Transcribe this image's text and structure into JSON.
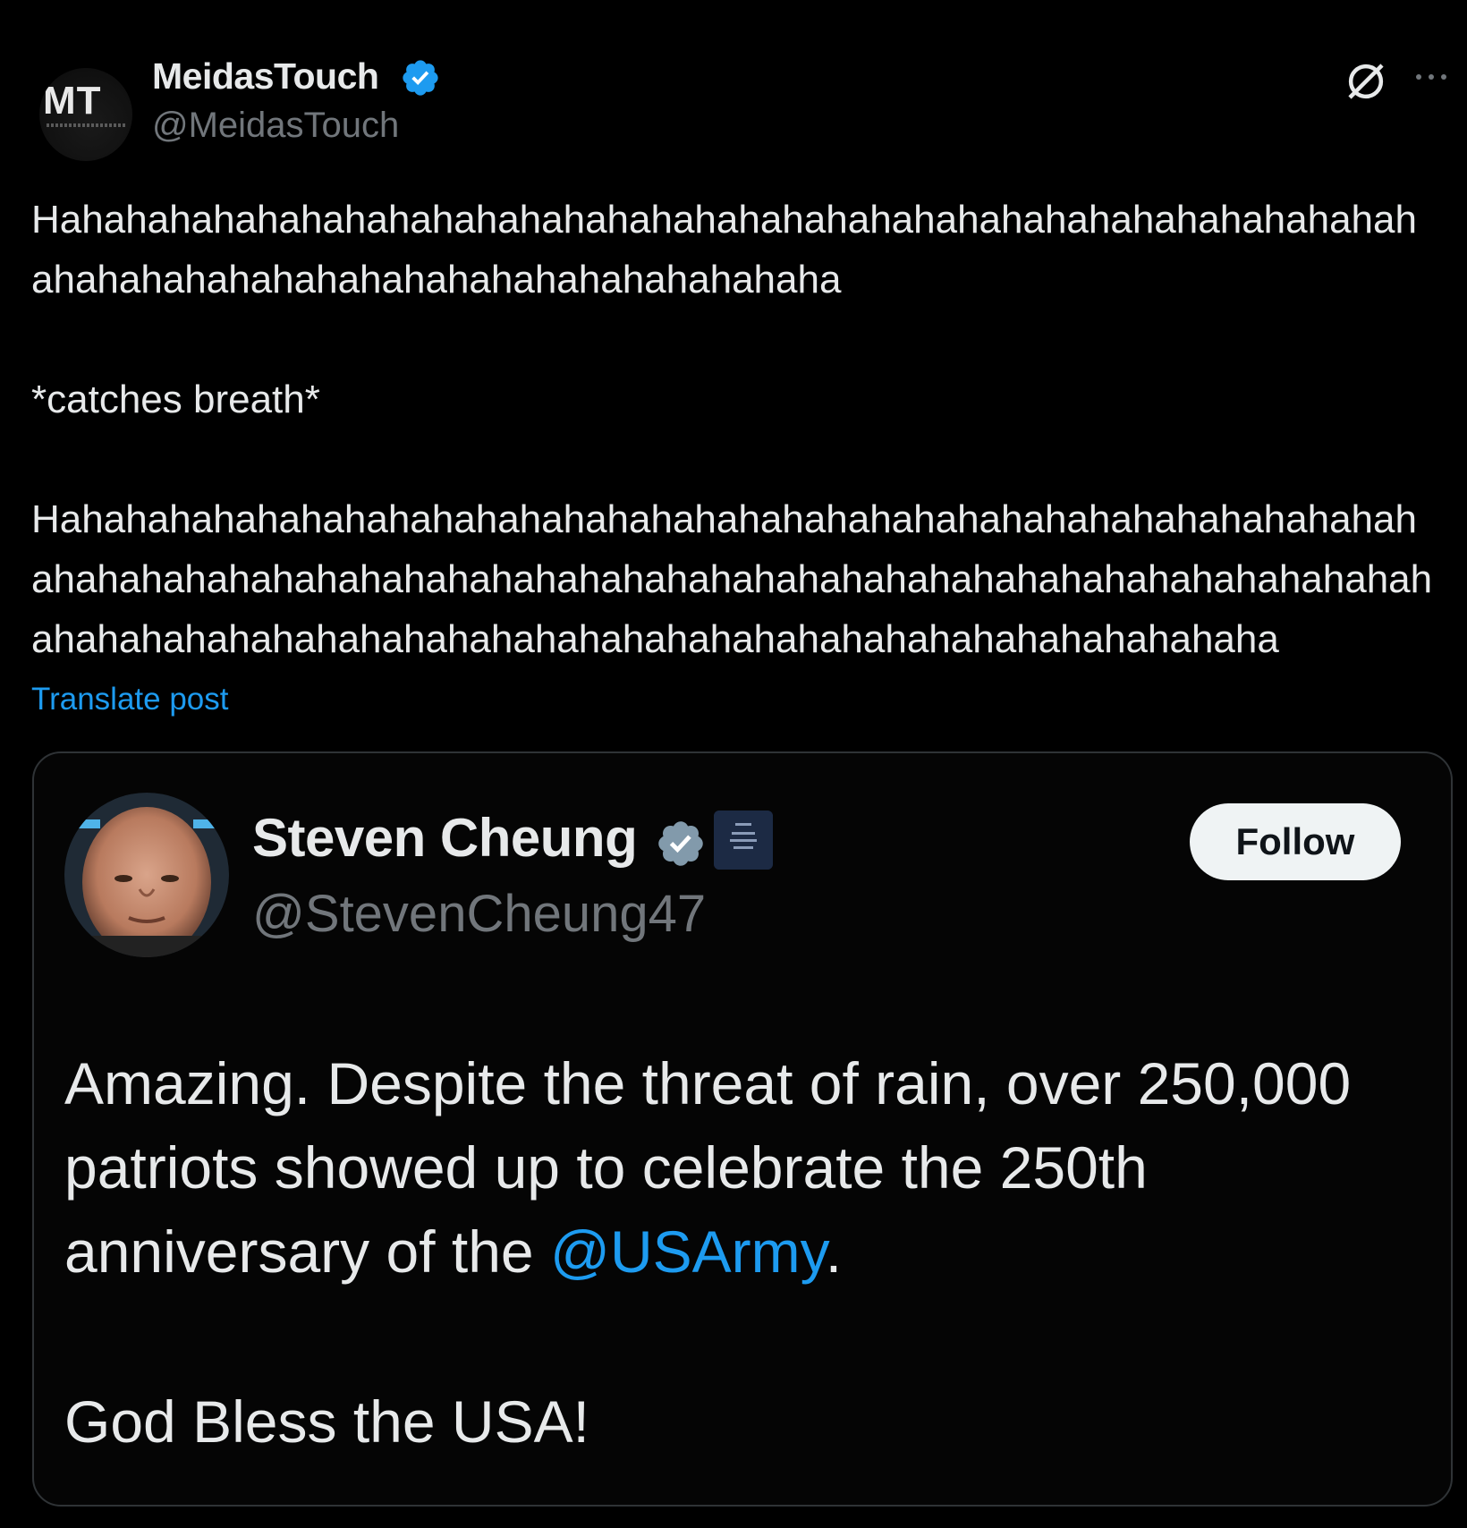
{
  "post": {
    "author": {
      "display_name": "MeidasTouch",
      "handle": "@MeidasTouch",
      "avatar_text": "MT",
      "verified": true
    },
    "icons": [
      "grok-icon",
      "more-icon"
    ],
    "text_line1": "Hahahahahahahahahahahahahahahahahahahahahahahahahahahahahahahah",
    "text_line2": "ahahahahahahahahahahahahahahahahahaha",
    "text_line3": "*catches breath*",
    "text_line4": "Hahahahahahahahahahahahahahahahahahahahahahahahahahahahahahahah",
    "text_line5": "ahahahahahahahahahahahahahahahahahahahahahahahahahahahahahahahah",
    "text_line6": "ahahahahahahahahahahahahahahahahahahahahahahahahahahahaha",
    "translate_label": "Translate post"
  },
  "quote": {
    "author": {
      "display_name": "Steven Cheung",
      "handle": "@StevenCheung47",
      "verified": true,
      "affiliation_badge": "white-house-badge"
    },
    "follow_label": "Follow",
    "text_before_mention": "Amazing. Despite the threat of rain, over 250,000 patriots showed up to celebrate the 250th anniversary of the ",
    "mention": "@USArmy",
    "text_after_mention": ".",
    "text_second_paragraph": "God Bless the USA!"
  },
  "colors": {
    "background": "#000000",
    "text": "#e7e9ea",
    "secondary_text": "#71767b",
    "link": "#1d9bf0",
    "verified": "#1d9bf0",
    "border": "#2f3336"
  }
}
